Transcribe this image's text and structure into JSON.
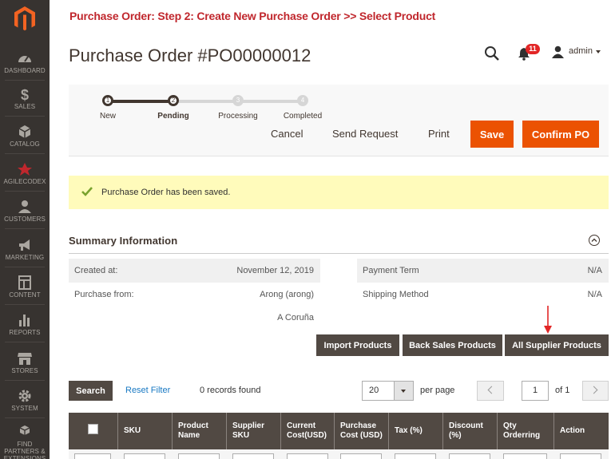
{
  "annotation": "Purchase Order: Step 2: Create New Purchase Order >> Select Product",
  "sidebar": {
    "items": [
      {
        "label": "DASHBOARD",
        "icon": "dashboard-icon"
      },
      {
        "label": "SALES",
        "icon": "dollar-icon"
      },
      {
        "label": "CATALOG",
        "icon": "cube-icon"
      },
      {
        "label": "AGILECODEX",
        "icon": "agilecodex-icon"
      },
      {
        "label": "CUSTOMERS",
        "icon": "person-icon"
      },
      {
        "label": "MARKETING",
        "icon": "megaphone-icon"
      },
      {
        "label": "CONTENT",
        "icon": "layout-icon"
      },
      {
        "label": "REPORTS",
        "icon": "bar-chart-icon"
      },
      {
        "label": "STORES",
        "icon": "store-icon"
      },
      {
        "label": "SYSTEM",
        "icon": "gear-icon"
      },
      {
        "label": "FIND PARTNERS & EXTENSIONS",
        "icon": "cubes-icon"
      }
    ]
  },
  "header": {
    "title": "Purchase Order #PO00000012",
    "notifications": "11",
    "user": "admin"
  },
  "steps": [
    {
      "num": "1",
      "label": "New",
      "state": "done"
    },
    {
      "num": "2",
      "label": "Pending",
      "state": "current"
    },
    {
      "num": "3",
      "label": "Processing",
      "state": "todo"
    },
    {
      "num": "4",
      "label": "Completed",
      "state": "todo"
    }
  ],
  "actions": {
    "cancel": "Cancel",
    "send_request": "Send Request",
    "print": "Print",
    "save": "Save",
    "confirm": "Confirm PO"
  },
  "message": "Purchase Order has been saved.",
  "summary": {
    "title": "Summary Information",
    "created_label": "Created at:",
    "created_value": "November 12, 2019",
    "purchase_from_label": "Purchase from:",
    "purchase_from_value": "Arong (arong)",
    "purchase_from_city": "A Coruña",
    "payment_term_label": "Payment Term",
    "payment_term_value": "N/A",
    "shipping_label": "Shipping Method",
    "shipping_value": "N/A"
  },
  "product_buttons": {
    "import": "Import Products",
    "back_sales": "Back Sales Products",
    "all_supplier": "All Supplier Products"
  },
  "grid": {
    "search": "Search",
    "reset": "Reset Filter",
    "records": "0 records found",
    "per_page_value": "20",
    "per_page_label": "per page",
    "page": "1",
    "of": "of 1",
    "columns": [
      "SKU",
      "Product Name",
      "Supplier SKU",
      "Current Cost(USD)",
      "Purchase Cost (USD)",
      "Tax (%)",
      "Discount (%)",
      "Qty Orderring",
      "Action"
    ]
  },
  "colors": {
    "accent": "#eb5202",
    "sidebar": "#373330",
    "dark_button": "#514943",
    "link": "#1979c3",
    "annotation": "#c0272d",
    "notice": "#fffbbb"
  }
}
